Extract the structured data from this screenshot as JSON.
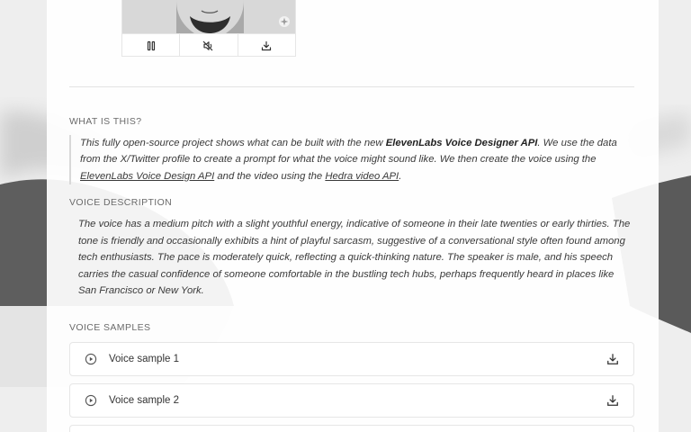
{
  "media_controls": {
    "pause_icon": "pause-icon",
    "mute_icon": "speaker-muted-icon",
    "download_icon": "download-icon"
  },
  "about": {
    "heading": "WHAT IS THIS?",
    "text_1": "This fully open-source project shows what can be built with the new ",
    "bold": "ElevenLabs Voice Designer API",
    "text_2": ". We use the data from the X/Twitter profile to create a prompt for what the voice might sound like. We then create the voice using the ",
    "link_1": "ElevenLabs Voice Design API",
    "text_3": " and the video using the ",
    "link_2": "Hedra video API",
    "text_4": "."
  },
  "voice_description": {
    "heading": "VOICE DESCRIPTION",
    "text": "The voice has a medium pitch with a slight youthful energy, indicative of someone in their late twenties or early thirties. The tone is friendly and occasionally exhibits a hint of playful sarcasm, suggestive of a conversational style often found among tech enthusiasts. The pace is moderately quick, reflecting a quick-thinking nature. The speaker is male, and his speech carries the casual confidence of someone comfortable in the bustling tech hubs, perhaps frequently heard in places like San Francisco or New York."
  },
  "voice_samples": {
    "heading": "VOICE SAMPLES",
    "items": [
      {
        "label": "Voice sample 1"
      },
      {
        "label": "Voice sample 2"
      }
    ]
  },
  "colors": {
    "background": "#ececec",
    "card": "#ffffff",
    "wave_dark": "#5a5a5a"
  }
}
